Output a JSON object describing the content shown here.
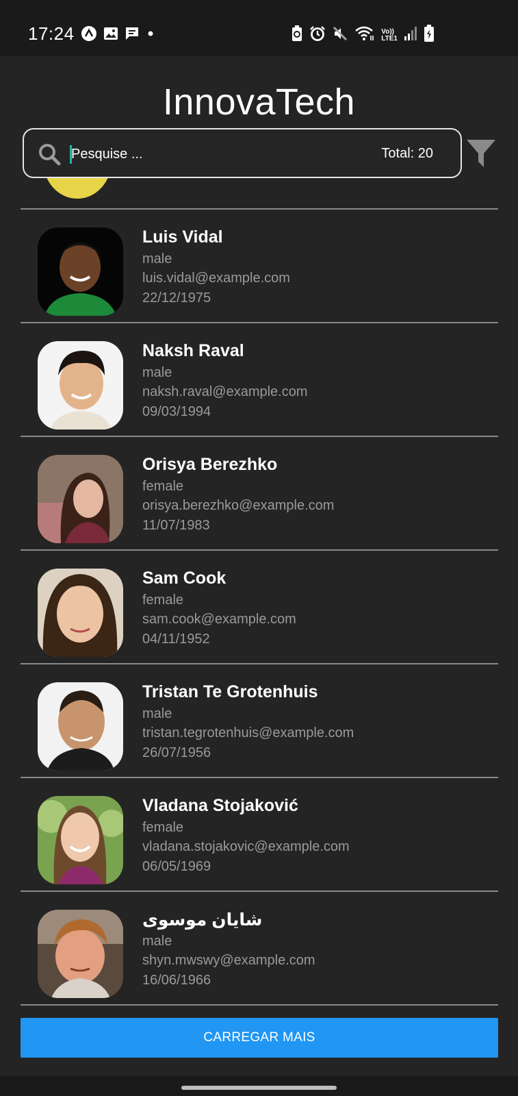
{
  "status_bar": {
    "time": "17:24",
    "left_icons": [
      "app-a-icon",
      "image-icon",
      "chat-icon",
      "dot-icon"
    ],
    "right_icons": [
      "data-saver-icon",
      "alarm-icon",
      "mute-icon",
      "wifi-icon",
      "volte-lte-icon",
      "signal-icon",
      "battery-charging-icon"
    ],
    "network_label_top": "Vo))",
    "network_label_bottom": "LTE1"
  },
  "app": {
    "title": "InnovaTech"
  },
  "search": {
    "placeholder": "Pesquise ...",
    "value": "",
    "total_label": "Total: 20",
    "icon": "search-icon"
  },
  "filter": {
    "icon": "filter-icon"
  },
  "users": [
    {
      "name": "Luis Vidal",
      "gender": "male",
      "email": "luis.vidal@example.com",
      "dob": "22/12/1975"
    },
    {
      "name": "Naksh Raval",
      "gender": "male",
      "email": "naksh.raval@example.com",
      "dob": "09/03/1994"
    },
    {
      "name": "Orisya Berezhko",
      "gender": "female",
      "email": "orisya.berezhko@example.com",
      "dob": "11/07/1983"
    },
    {
      "name": "Sam Cook",
      "gender": "female",
      "email": "sam.cook@example.com",
      "dob": "04/11/1952"
    },
    {
      "name": "Tristan Te Grotenhuis",
      "gender": "male",
      "email": "tristan.tegrotenhuis@example.com",
      "dob": "26/07/1956"
    },
    {
      "name": "Vladana Stojaković",
      "gender": "female",
      "email": "vladana.stojakovic@example.com",
      "dob": "06/05/1969"
    },
    {
      "name": "شايان موسوی",
      "gender": "male",
      "email": "shyn.mwswy@example.com",
      "dob": "16/06/1966"
    }
  ],
  "load_more": {
    "label": "CARREGAR MAIS"
  },
  "colors": {
    "background": "#242424",
    "status_bar": "#1a1a1a",
    "button": "#2196f3",
    "secondary_text": "#9a9a9a",
    "divider": "#8a8a8a",
    "cursor": "#1fb8a8"
  }
}
